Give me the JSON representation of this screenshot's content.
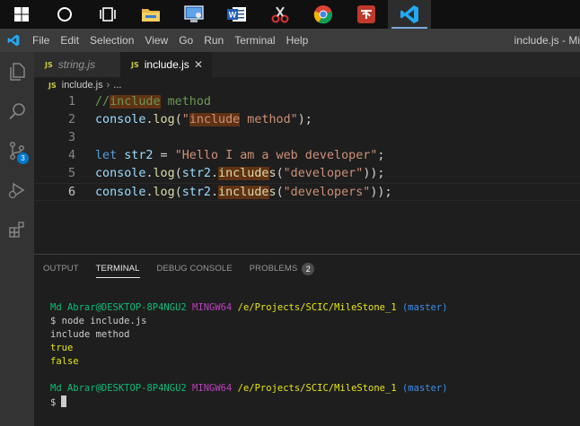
{
  "taskbar": {
    "apps": [
      "windows-start",
      "search",
      "task-view",
      "file-explorer",
      "control-panel",
      "word",
      "snipping-tool",
      "chrome",
      "bijoy",
      "vscode"
    ]
  },
  "menubar": {
    "items": [
      "File",
      "Edit",
      "Selection",
      "View",
      "Go",
      "Run",
      "Terminal",
      "Help"
    ],
    "window_title": "include.js - Mi"
  },
  "activitybar": {
    "items": [
      "explorer-icon",
      "search-icon",
      "source-control-icon",
      "run-debug-icon",
      "extensions-icon"
    ],
    "source_control_badge": "3"
  },
  "tabs": [
    {
      "label": "string.js",
      "active": false
    },
    {
      "label": "include.js",
      "active": true,
      "close": "✕"
    }
  ],
  "breadcrumb": {
    "file": "include.js",
    "separator": "›",
    "rest": "..."
  },
  "editor": {
    "lines": [
      {
        "num": "1",
        "tokens": [
          {
            "t": "//",
            "c": "c-comment"
          },
          {
            "t": "include",
            "c": "c-comment hl"
          },
          {
            "t": " method",
            "c": "c-comment"
          }
        ]
      },
      {
        "num": "2",
        "tokens": [
          {
            "t": "console",
            "c": "c-var"
          },
          {
            "t": ".",
            "c": "c-punc"
          },
          {
            "t": "log",
            "c": "c-fn"
          },
          {
            "t": "(",
            "c": "c-punc"
          },
          {
            "t": "\"",
            "c": "c-str"
          },
          {
            "t": "include",
            "c": "c-str hl"
          },
          {
            "t": " method\"",
            "c": "c-str"
          },
          {
            "t": ");",
            "c": "c-punc"
          }
        ]
      },
      {
        "num": "3",
        "tokens": []
      },
      {
        "num": "4",
        "tokens": [
          {
            "t": "let",
            "c": "c-kw"
          },
          {
            "t": " ",
            "c": "c-punc"
          },
          {
            "t": "str2",
            "c": "c-var"
          },
          {
            "t": " = ",
            "c": "c-punc"
          },
          {
            "t": "\"Hello I am a web developer\"",
            "c": "c-str"
          },
          {
            "t": ";",
            "c": "c-punc"
          }
        ]
      },
      {
        "num": "5",
        "tokens": [
          {
            "t": "console",
            "c": "c-var"
          },
          {
            "t": ".",
            "c": "c-punc"
          },
          {
            "t": "log",
            "c": "c-fn"
          },
          {
            "t": "(",
            "c": "c-punc"
          },
          {
            "t": "str2",
            "c": "c-var"
          },
          {
            "t": ".",
            "c": "c-punc"
          },
          {
            "t": "include",
            "c": "c-fn hl"
          },
          {
            "t": "s",
            "c": "c-fn"
          },
          {
            "t": "(",
            "c": "c-punc"
          },
          {
            "t": "\"developer\"",
            "c": "c-str"
          },
          {
            "t": "));",
            "c": "c-punc"
          }
        ]
      },
      {
        "num": "6",
        "tokens": [
          {
            "t": "console",
            "c": "c-var"
          },
          {
            "t": ".",
            "c": "c-punc"
          },
          {
            "t": "log",
            "c": "c-fn"
          },
          {
            "t": "(",
            "c": "c-punc"
          },
          {
            "t": "str2",
            "c": "c-var"
          },
          {
            "t": ".",
            "c": "c-punc"
          },
          {
            "t": "include",
            "c": "c-fn hl"
          },
          {
            "t": "s",
            "c": "c-fn"
          },
          {
            "t": "(",
            "c": "c-punc"
          },
          {
            "t": "\"developers\"",
            "c": "c-str"
          },
          {
            "t": "));",
            "c": "c-punc"
          }
        ]
      }
    ],
    "current_line": "6"
  },
  "panel": {
    "tabs": [
      {
        "label": "OUTPUT",
        "active": false
      },
      {
        "label": "TERMINAL",
        "active": true
      },
      {
        "label": "DEBUG CONSOLE",
        "active": false
      },
      {
        "label": "PROBLEMS",
        "active": false,
        "badge": "2"
      }
    ]
  },
  "terminal": {
    "prompt1": {
      "user": "Md Abrar@DESKTOP-8P4NGU2",
      "shell": "MINGW64",
      "path": "/e/Projects/SCIC/MileStone_1",
      "branch": "(master)"
    },
    "command": "$ node include.js",
    "output": [
      "include method",
      "true",
      "false"
    ],
    "prompt2": {
      "user": "Md Abrar@DESKTOP-8P4NGU2",
      "shell": "MINGW64",
      "path": "/e/Projects/SCIC/MileStone_1",
      "branch": "(master)"
    },
    "input_prompt": "$"
  },
  "colors": {
    "accent": "#007acc",
    "editor_bg": "#1e1e1e",
    "sidebar_bg": "#333333",
    "menubar_bg": "#3c3c3c"
  }
}
